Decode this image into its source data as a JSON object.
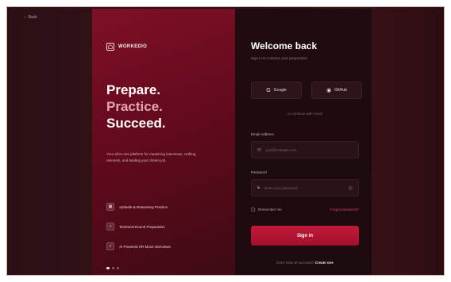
{
  "nav": {
    "back_label": "Back"
  },
  "brand": {
    "name": "WORKEDIO",
    "accent": "#c01a3a"
  },
  "headline": {
    "line1": "Prepare.",
    "line2": "Practice.",
    "line3": "Succeed."
  },
  "promo": {
    "description": "Your all-in-one platform for mastering interviews, crafting resumes, and landing your dream job.",
    "features": [
      {
        "icon": "chart-icon",
        "label": "Aptitude & Reasoning Practice"
      },
      {
        "icon": "code-icon",
        "label": "Technical Round Preparation"
      },
      {
        "icon": "check-icon",
        "label": "AI-Powered HR Mock Interviews"
      }
    ]
  },
  "form": {
    "title": "Welcome back",
    "subtitle": "Sign in to continue your preparation",
    "social": {
      "google": "Google",
      "github": "GitHub"
    },
    "divider": "or continue with email",
    "email": {
      "label": "Email Address",
      "placeholder": "you@example.com"
    },
    "password": {
      "label": "Password",
      "placeholder": "Enter your password"
    },
    "remember": "Remember me",
    "forgot": "Forgot password?",
    "submit": "Sign in",
    "signup_prompt": "Don't have an account?",
    "signup_link": "Create one"
  }
}
